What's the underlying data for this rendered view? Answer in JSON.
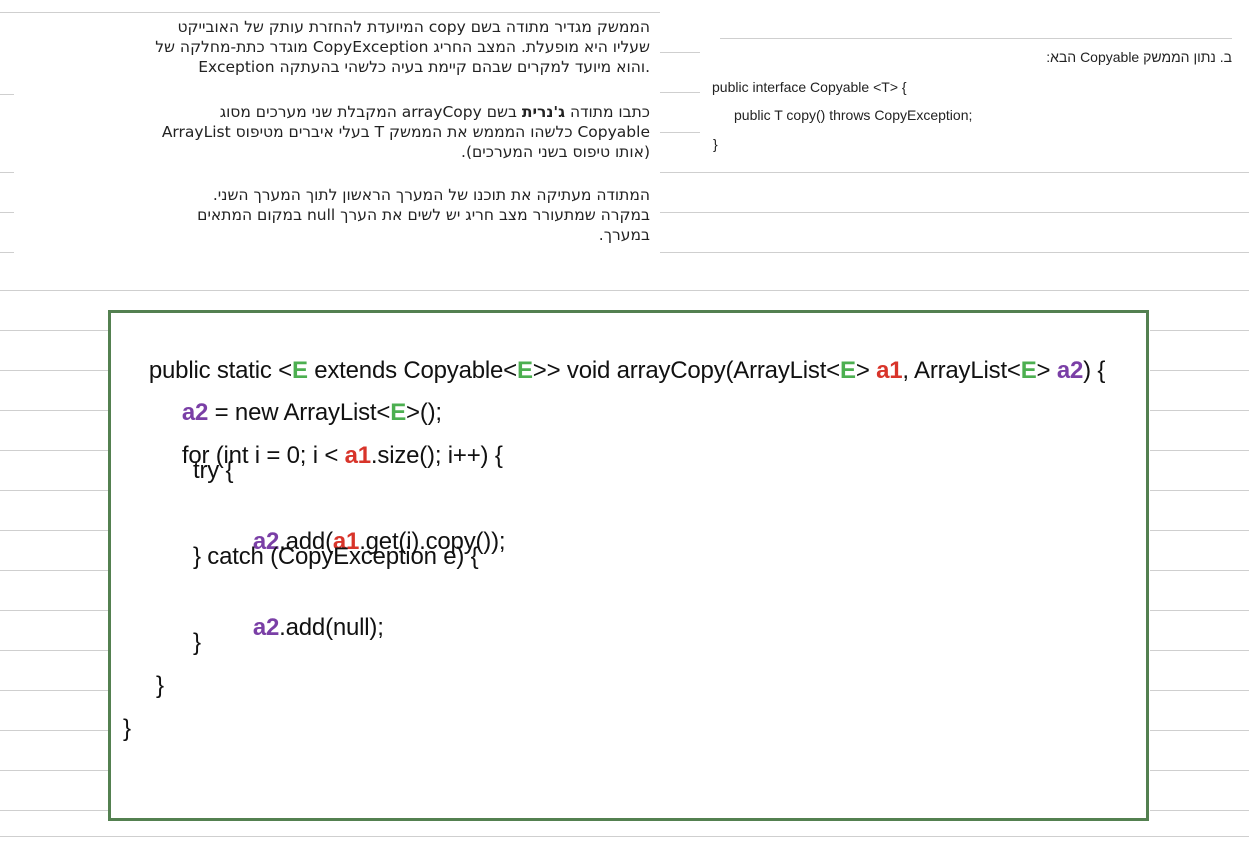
{
  "left_text": {
    "p1": {
      "l1": "הממשק מגדיר מתודה בשם copy המיועדת להחזרת עותק של האובייקט",
      "l2": "שעליו היא מופעלת. המצב החריג CopyException מוגדר כתת-מחלקה של",
      "l3": "Exception והוא מיועד למקרים שבהם קיימת בעיה כלשהי בהעתקה."
    },
    "p2": {
      "l1_pre": "כתבו מתודה ",
      "l1_bold": "ג'נרית",
      "l1_post": " בשם arrayCopy המקבלת שני מערכים מסוג",
      "l2": "ArrayList בעלי איברים מטיפוס T כלשהו המממש את הממשק Copyable",
      "l3": "(אותו טיפוס בשני המערכים)."
    },
    "p3": {
      "l1": "המתודה מעתיקה את תוכנו של המערך הראשון לתוך המערך השני.",
      "l2": "במקרה שמתעורר מצב חריג יש לשים את הערך null במקום המתאים",
      "l3": "במערך."
    }
  },
  "right_text": {
    "heading": "ב. נתון הממשק Copyable הבא:",
    "code1": "public interface Copyable <T> {",
    "code2": "public T copy() throws CopyException;",
    "code3": "}"
  },
  "code": {
    "line1": {
      "a": "public static <",
      "b": "E",
      "c": " extends Copyable<",
      "d": "E",
      "e": ">> void arrayCopy(ArrayList<",
      "f": "E",
      "g": "> ",
      "h": "a1",
      "i": ", ArrayList<",
      "j": "E",
      "k": "> ",
      "l": "a2",
      "m": ") {"
    },
    "line2": {
      "a": "a2",
      "b": " = new ArrayList<",
      "c": "E",
      "d": ">();"
    },
    "line3": {
      "a": "for (int i = 0; i < ",
      "b": "a1",
      "c": ".size(); i++) {"
    },
    "line4": "try {",
    "line5": {
      "a": "a2",
      "b": ".add(",
      "c": "a1",
      "d": ".get(i).copy());"
    },
    "line6": "} catch (CopyException e) {",
    "line7": {
      "a": "a2",
      "b": ".add(null);"
    },
    "line8": "}",
    "line9": "}",
    "line10": "}"
  },
  "colors": {
    "generic": "#4caf50",
    "param_a1": "#d8342a",
    "param_a2": "#7a3fa6",
    "box_border": "#538050"
  }
}
